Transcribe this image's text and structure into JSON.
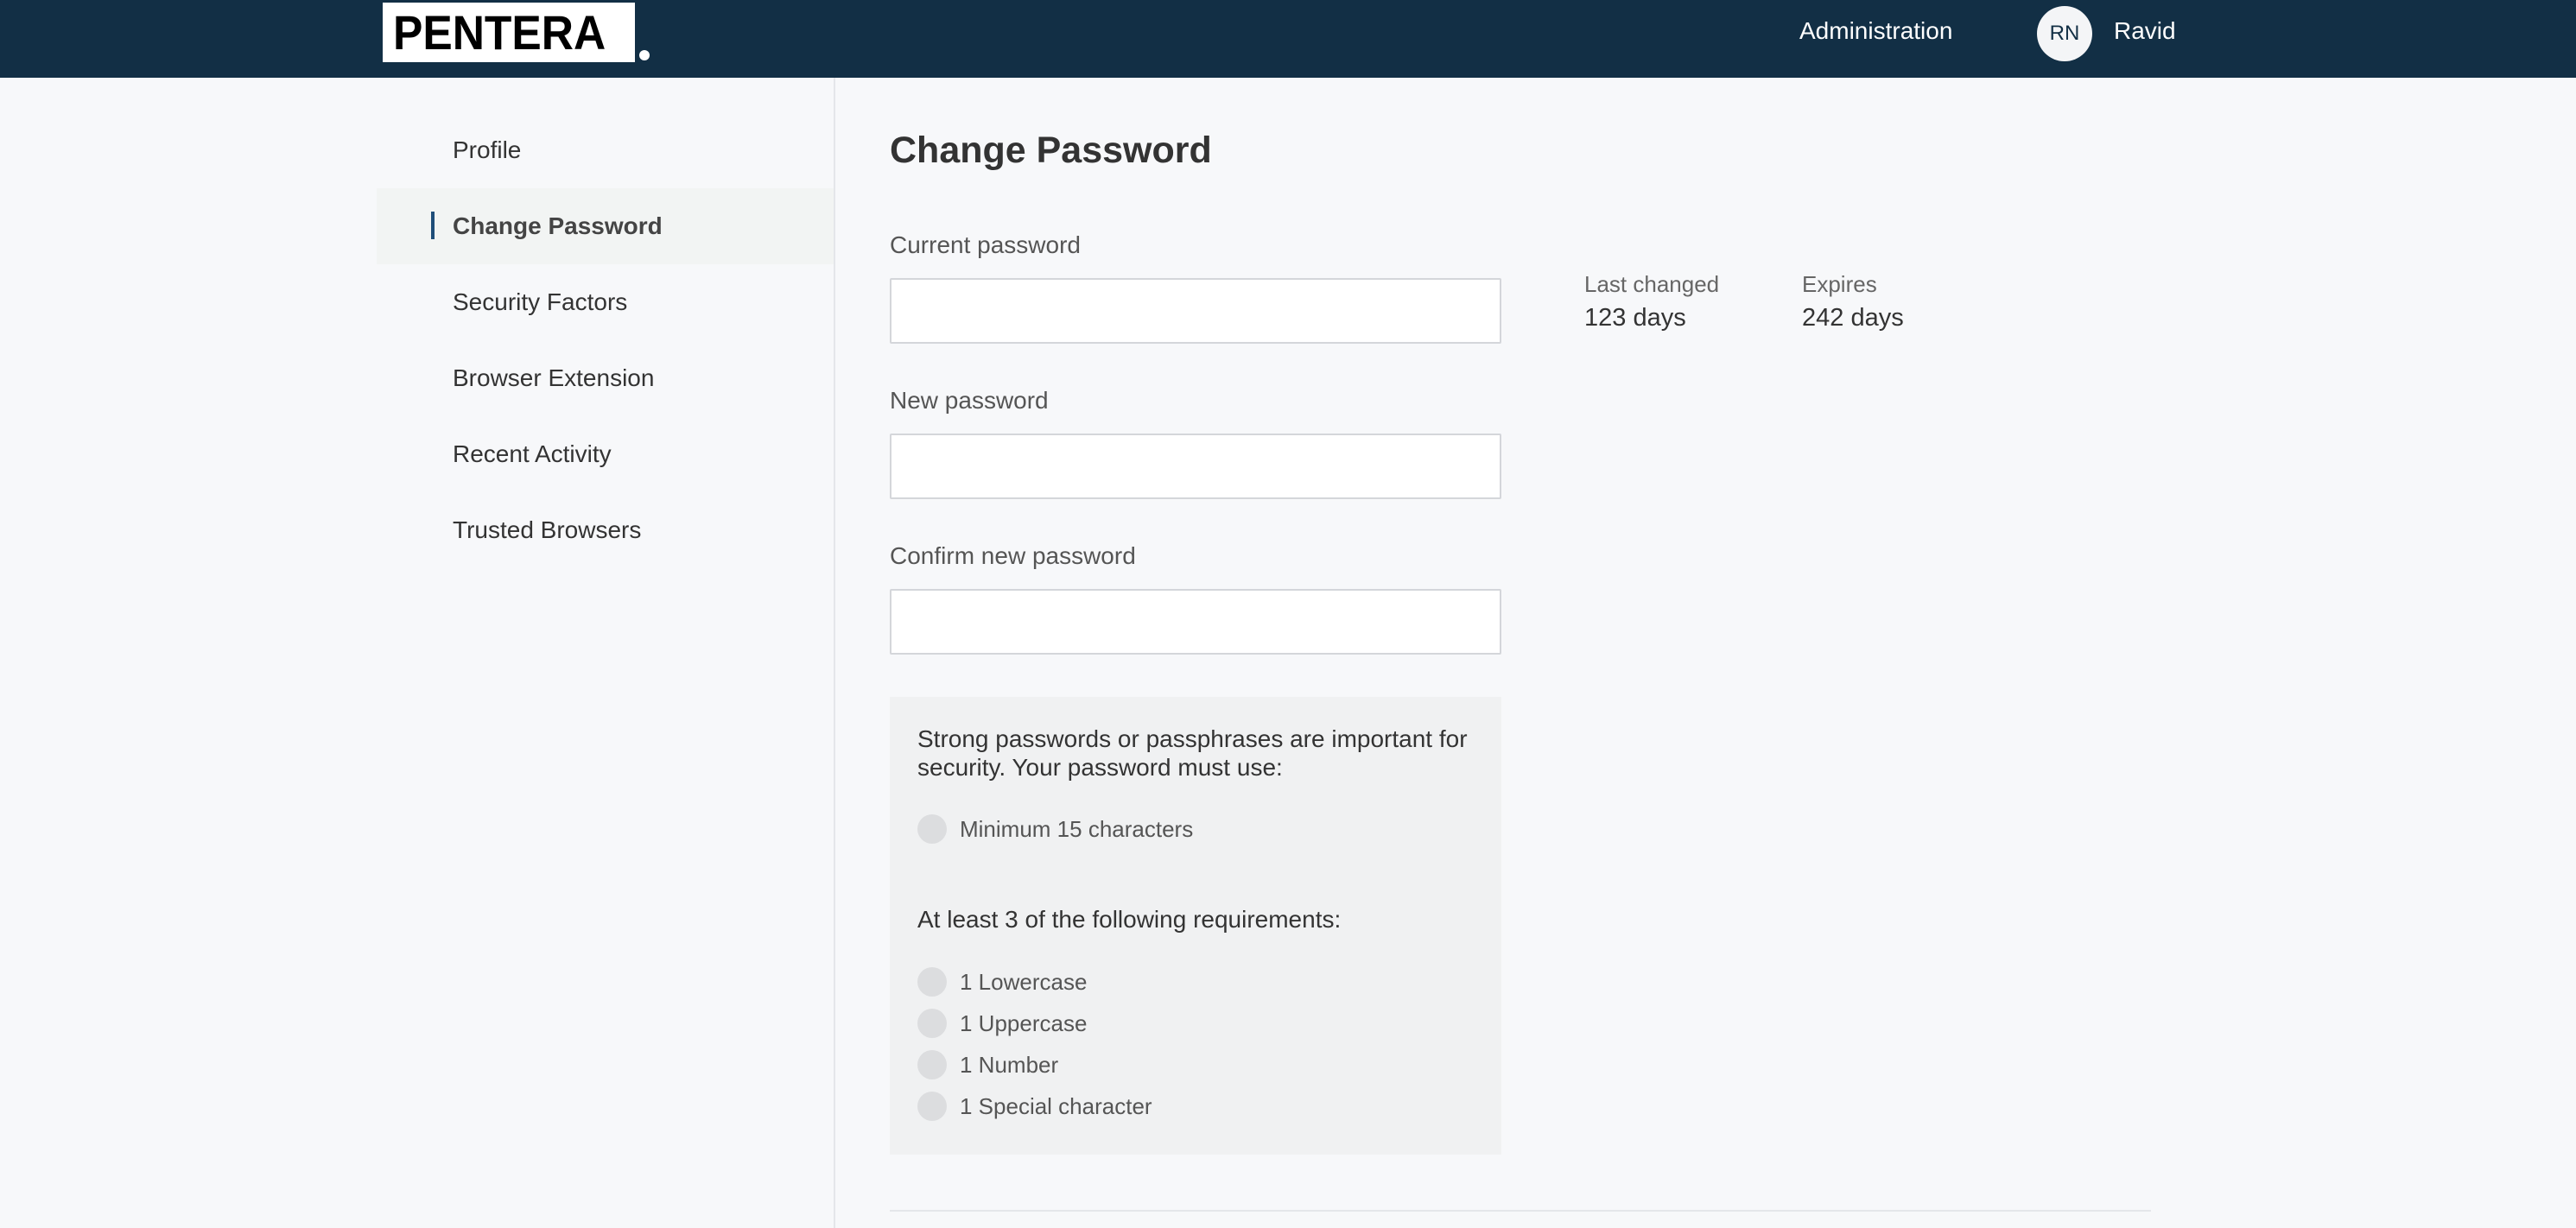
{
  "header": {
    "logo_text": "PENTERA",
    "admin_label": "Administration",
    "avatar_initials": "RN",
    "username": "Ravid"
  },
  "sidebar": {
    "items": [
      {
        "label": "Profile",
        "active": false
      },
      {
        "label": "Change Password",
        "active": true
      },
      {
        "label": "Security Factors",
        "active": false
      },
      {
        "label": "Browser Extension",
        "active": false
      },
      {
        "label": "Recent Activity",
        "active": false
      },
      {
        "label": "Trusted Browsers",
        "active": false
      }
    ]
  },
  "main": {
    "title": "Change Password",
    "fields": [
      {
        "label": "Current password",
        "value": "",
        "placeholder": ""
      },
      {
        "label": "New password",
        "value": "",
        "placeholder": ""
      },
      {
        "label": "Confirm new password",
        "value": "",
        "placeholder": ""
      }
    ],
    "meta": {
      "last_changed_label": "Last changed",
      "last_changed_value": "123 days",
      "expires_label": "Expires",
      "expires_value": "242 days"
    },
    "requirements": {
      "intro_line1": "Strong passwords or passphrases are important for",
      "intro_line2": "security. Your password must use:",
      "minimum": "Minimum 15 characters",
      "subheading": "At least 3 of the following requirements:",
      "items": [
        "1 Lowercase",
        "1 Uppercase",
        "1 Number",
        "1 Special character"
      ]
    }
  },
  "colors": {
    "header_bg": "#122f45",
    "page_bg": "#f7f8fa",
    "active_indicator": "#1f4e79"
  }
}
